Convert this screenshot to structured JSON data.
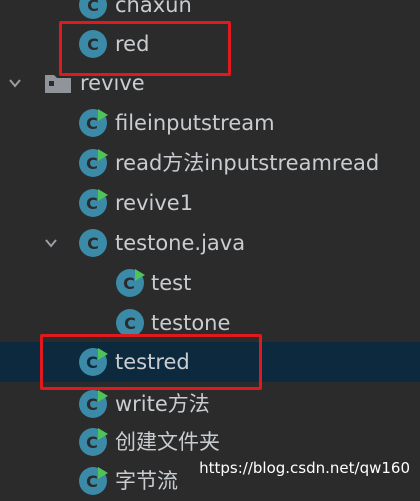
{
  "tree": {
    "items": [
      {
        "label": "chaxun"
      },
      {
        "label": "red"
      },
      {
        "label": "revive"
      },
      {
        "label": "fileinputstream"
      },
      {
        "label": "read方法inputstreamread"
      },
      {
        "label": "revive1"
      },
      {
        "label": "testone.java"
      },
      {
        "label": "test"
      },
      {
        "label": "testone"
      },
      {
        "label": "testred"
      },
      {
        "label": "write方法"
      },
      {
        "label": "创建文件夹"
      },
      {
        "label": "字节流"
      }
    ]
  },
  "watermark": "https://blog.csdn.net/qw160",
  "colors": {
    "background": "#2b2b2b",
    "selection": "#0d293e",
    "highlight_box": "#e0191f",
    "class_icon": "#3a8aa8",
    "run_marker": "#4fc35a",
    "text": "#c9cdd1"
  },
  "icons": {
    "class": "java-class-icon",
    "runnable_class": "java-runnable-class-icon",
    "package": "package-folder-icon",
    "expanded": "chevron-down-icon"
  }
}
